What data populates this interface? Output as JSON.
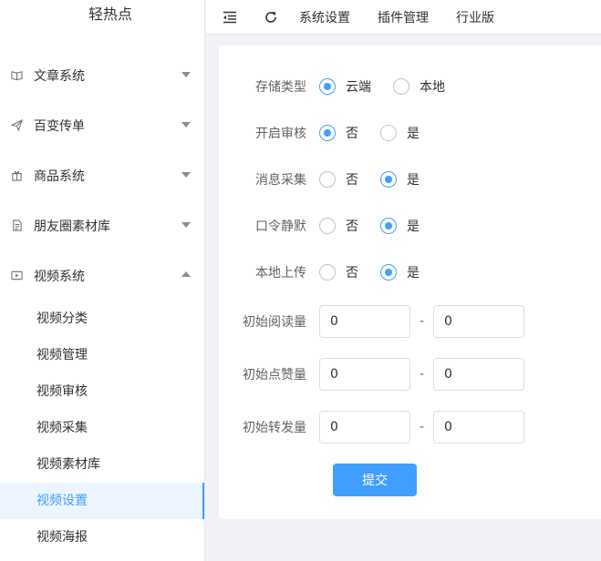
{
  "app": {
    "title": "轻热点"
  },
  "sidebar": {
    "menus": [
      {
        "label": "文章系统",
        "icon": "book-icon"
      },
      {
        "label": "百变传单",
        "icon": "paper-plane-icon"
      },
      {
        "label": "商品系统",
        "icon": "gift-icon"
      },
      {
        "label": "朋友圈素材库",
        "icon": "document-icon"
      },
      {
        "label": "视频系统",
        "icon": "video-icon"
      }
    ],
    "video_submenu": [
      {
        "label": "视频分类"
      },
      {
        "label": "视频管理"
      },
      {
        "label": "视频审核"
      },
      {
        "label": "视频采集"
      },
      {
        "label": "视频素材库"
      },
      {
        "label": "视频设置"
      },
      {
        "label": "视频海报"
      }
    ],
    "active_item": "视频设置"
  },
  "topbar": {
    "links": [
      "系统设置",
      "插件管理",
      "行业版"
    ]
  },
  "form": {
    "storage_type": {
      "label": "存储类型",
      "options": [
        "云端",
        "本地"
      ],
      "selected": "云端"
    },
    "enable_review": {
      "label": "开启审核",
      "options": [
        "否",
        "是"
      ],
      "selected": "否"
    },
    "message_collect": {
      "label": "消息采集",
      "options": [
        "否",
        "是"
      ],
      "selected": "是"
    },
    "password_silent": {
      "label": "口令静默",
      "options": [
        "否",
        "是"
      ],
      "selected": "是"
    },
    "local_upload": {
      "label": "本地上传",
      "options": [
        "否",
        "是"
      ],
      "selected": "是"
    },
    "init_read": {
      "label": "初始阅读量",
      "min": "0",
      "max": "0"
    },
    "init_like": {
      "label": "初始点赞量",
      "min": "0",
      "max": "0"
    },
    "init_share": {
      "label": "初始转发量",
      "min": "0",
      "max": "0"
    },
    "range_separator": "-",
    "submit_label": "提交"
  },
  "colors": {
    "accent": "#409eff",
    "background": "#f0f2f5"
  }
}
